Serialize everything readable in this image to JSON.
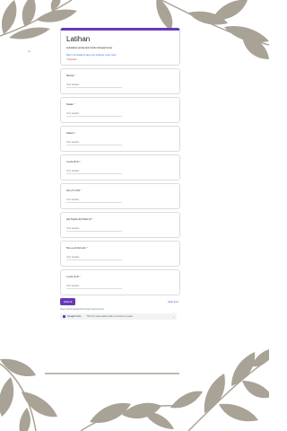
{
  "side_label": "•••",
  "header": {
    "title": "Latihan",
    "description": "selesaikan persamaan berikut dengan benar",
    "account_text": "Sign in to Google to save your progress.",
    "account_link": "Learn more",
    "required_note": "* Required"
  },
  "questions": [
    {
      "label": "Nama",
      "required": "*",
      "placeholder": "Your answer"
    },
    {
      "label": "Kelas",
      "required": "*",
      "placeholder": "Your answer"
    },
    {
      "label": "Absen",
      "required": "*",
      "placeholder": "Your answer"
    },
    {
      "label": "x²+2x-8=0",
      "required": "*",
      "placeholder": "Your answer"
    },
    {
      "label": "2x²+7x-4=0",
      "required": "*",
      "placeholder": "Your answer"
    },
    {
      "label": "(2x-5)(3x+4)=5(4x-3)",
      "required": "*",
      "placeholder": "Your answer"
    },
    {
      "label": "5x²+x+2=2x²+3x",
      "required": "*",
      "placeholder": "Your answer"
    },
    {
      "label": "x²+2x-3=0",
      "required": "*",
      "placeholder": "Your answer"
    }
  ],
  "actions": {
    "submit_label": "Submit",
    "clear_label": "Clear form"
  },
  "footer": {
    "note": "Never submit passwords through Google Forms.",
    "brand": "Google Forms",
    "message": "This form was created inside of a school or a team.",
    "arrow": "›"
  },
  "colors": {
    "accent": "#673ab7",
    "leaf": "#a8a396",
    "required": "#d93025",
    "link": "#1a73e8"
  }
}
